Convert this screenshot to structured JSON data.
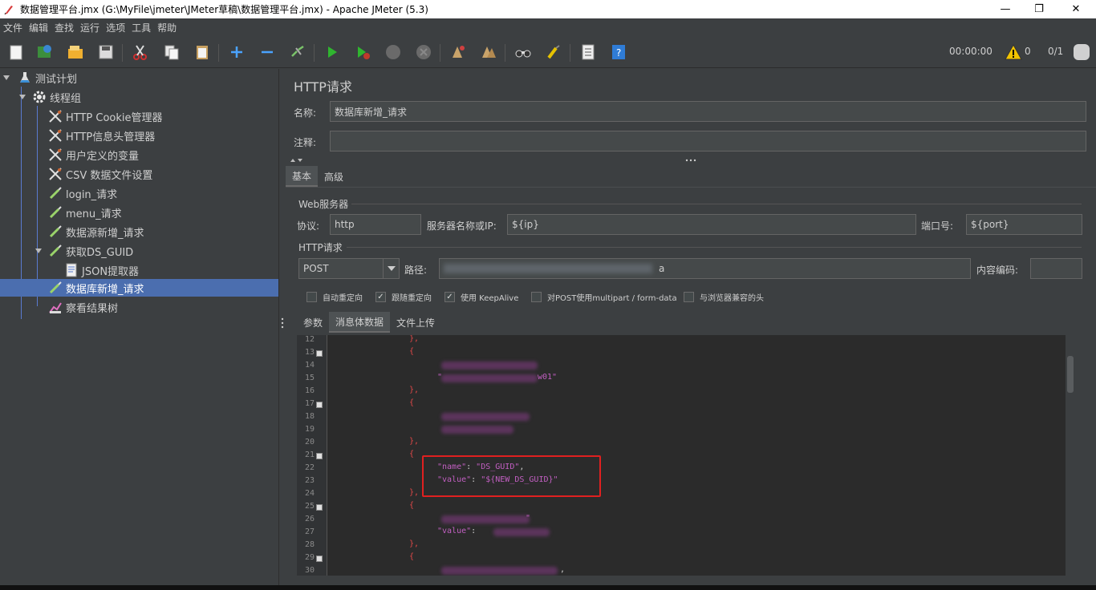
{
  "window": {
    "title": "数据管理平台.jmx (G:\\MyFile\\jmeter\\JMeter草稿\\数据管理平台.jmx) - Apache JMeter (5.3)",
    "minimize": "—",
    "restore": "❐",
    "close": "✕"
  },
  "menu": [
    "文件",
    "编辑",
    "查找",
    "运行",
    "选项",
    "工具",
    "帮助"
  ],
  "toolbar": {
    "timer": "00:00:00",
    "warnings": "0",
    "threads": "0/1"
  },
  "tree": {
    "items": [
      {
        "label": "测试计划",
        "icon": "flask-icon"
      },
      {
        "label": "线程组",
        "icon": "gear-icon"
      },
      {
        "label": "HTTP Cookie管理器",
        "icon": "wrench-icon"
      },
      {
        "label": "HTTP信息头管理器",
        "icon": "wrench-icon"
      },
      {
        "label": "用户定义的变量",
        "icon": "wrench-icon"
      },
      {
        "label": "CSV 数据文件设置",
        "icon": "wrench-icon"
      },
      {
        "label": "login_请求",
        "icon": "pipette-icon"
      },
      {
        "label": "menu_请求",
        "icon": "pipette-icon"
      },
      {
        "label": "数据源新增_请求",
        "icon": "pipette-icon"
      },
      {
        "label": "获取DS_GUID",
        "icon": "pipette-icon"
      },
      {
        "label": "JSON提取器",
        "icon": "document-icon"
      },
      {
        "label": "数据库新增_请求",
        "icon": "pipette-icon"
      },
      {
        "label": "察看结果树",
        "icon": "chart-icon"
      }
    ]
  },
  "panel": {
    "title": "HTTP请求",
    "name_label": "名称:",
    "name_value": "数据库新增_请求",
    "comment_label": "注释:",
    "comment_value": "",
    "tabs": [
      "基本",
      "高级"
    ],
    "web_server": {
      "group_title": "Web服务器",
      "protocol_label": "协议:",
      "protocol_value": "http",
      "server_label": "服务器名称或IP:",
      "server_value": "${ip}",
      "port_label": "端口号:",
      "port_value": "${port}"
    },
    "http_request": {
      "group_title": "HTTP请求",
      "method": "POST",
      "path_label": "路径:",
      "path_value": "a",
      "encoding_label": "内容编码:",
      "encoding_value": ""
    },
    "checkboxes": [
      {
        "label": "自动重定向",
        "checked": false
      },
      {
        "label": "跟随重定向",
        "checked": true
      },
      {
        "label": "使用 KeepAlive",
        "checked": true
      },
      {
        "label": "对POST使用multipart / form-data",
        "checked": false
      },
      {
        "label": "与浏览器兼容的头",
        "checked": false
      }
    ],
    "body_tabs": [
      "参数",
      "消息体数据",
      "文件上传"
    ]
  },
  "editor": {
    "line_numbers": [
      "12",
      "13",
      "14",
      "15",
      "16",
      "17",
      "18",
      "19",
      "20",
      "21",
      "22",
      "23",
      "24",
      "25",
      "26",
      "27",
      "28",
      "29",
      "30"
    ],
    "fold_lines": [
      "13",
      "17",
      "21",
      "25",
      "29"
    ],
    "lines": {
      "l12": "},",
      "l13": "{",
      "l15": "\"",
      "l15b": "w01\"",
      "l16": "},",
      "l17": "{",
      "l20": "},",
      "l21": "{",
      "l22_key": "\"name\"",
      "l22_sep": ": ",
      "l22_val": "\"DS_GUID\"",
      "l22_end": ",",
      "l23_key": "\"value\"",
      "l23_sep": ": ",
      "l23_val": "\"${NEW_DS_GUID}\"",
      "l24": "},",
      "l25": "{",
      "l26": "\"",
      "l27_key": "\"value\"",
      "l27_sep": ": ",
      "l28": "},",
      "l29": "{",
      "l30": ","
    }
  },
  "colors": {
    "background": "#3c3f41",
    "selected": "#4b6eaf",
    "editor_bg": "#2b2b2b",
    "code_key": "#c25fc2",
    "code_brace": "#e04848",
    "code_punct": "#cfcfcf",
    "highlight_box": "#e02020"
  }
}
